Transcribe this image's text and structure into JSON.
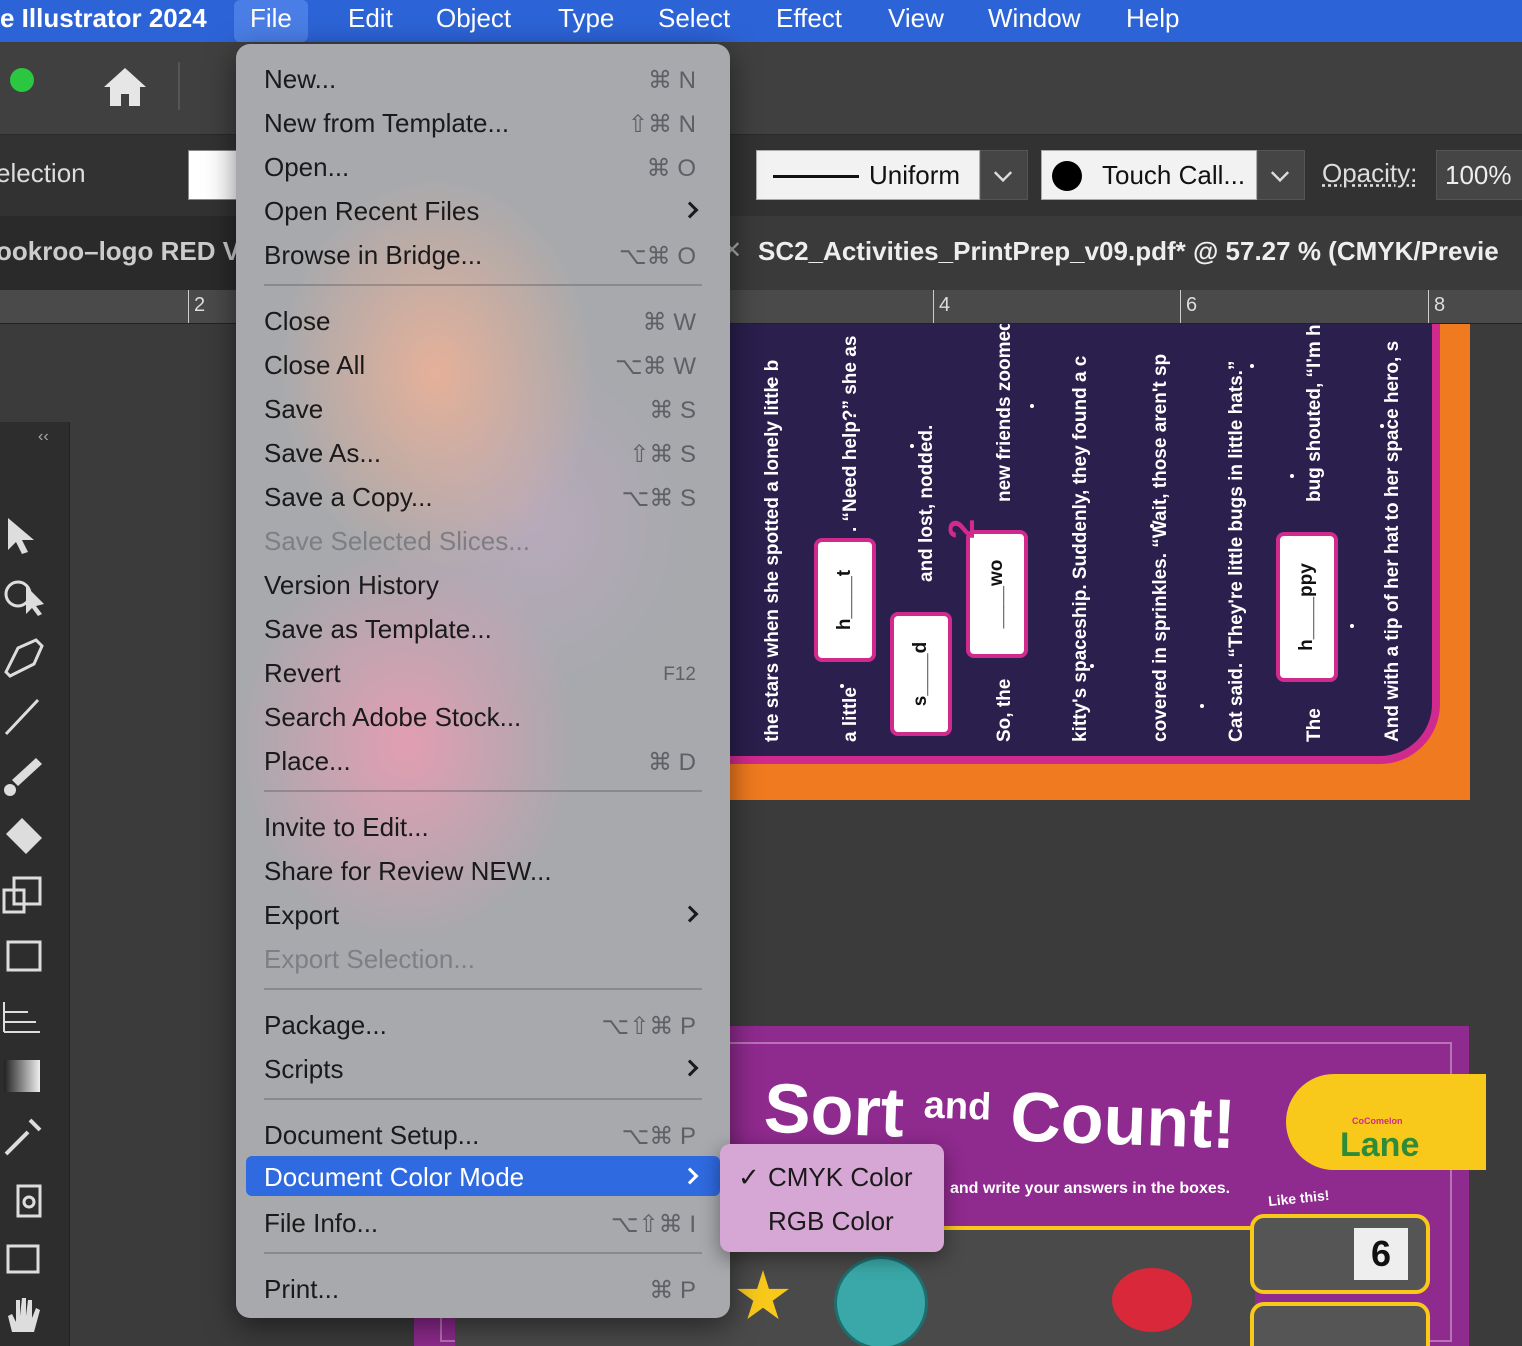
{
  "menubar": {
    "app_name": "e Illustrator 2024",
    "items": [
      "File",
      "Edit",
      "Object",
      "Type",
      "Select",
      "Effect",
      "View",
      "Window",
      "Help"
    ]
  },
  "control_bar": {
    "tool_label": "election",
    "stroke_profile": "Uniform",
    "brush": "Touch Call...",
    "opacity_label": "Opacity:",
    "opacity_value": "100%"
  },
  "tabs": {
    "inactive": "ookroo–logo RED V",
    "active_title": "SC2_Activities_PrintPrep_v09.pdf* @ 57.27 % (CMYK/Previe"
  },
  "ruler": {
    "labels": [
      "2",
      "4",
      "6",
      "8"
    ]
  },
  "file_menu": {
    "items": [
      {
        "label": "New...",
        "shortcut": "⌘ N"
      },
      {
        "label": "New from Template...",
        "shortcut": "⇧⌘ N"
      },
      {
        "label": "Open...",
        "shortcut": "⌘ O"
      },
      {
        "label": "Open Recent Files",
        "submenu": true
      },
      {
        "label": "Browse in Bridge...",
        "shortcut": "⌥⌘ O"
      },
      {
        "label": "Close",
        "shortcut": "⌘ W"
      },
      {
        "label": "Close All",
        "shortcut": "⌥⌘ W"
      },
      {
        "label": "Save",
        "shortcut": "⌘ S"
      },
      {
        "label": "Save As...",
        "shortcut": "⇧⌘ S"
      },
      {
        "label": "Save a Copy...",
        "shortcut": "⌥⌘ S"
      },
      {
        "label": "Save Selected Slices...",
        "disabled": true
      },
      {
        "label": "Version History"
      },
      {
        "label": "Save as Template..."
      },
      {
        "label": "Revert",
        "shortcut": "F12"
      },
      {
        "label": "Search Adobe Stock..."
      },
      {
        "label": "Place...",
        "shortcut": "⌘ D"
      },
      {
        "label": "Invite to Edit..."
      },
      {
        "label": "Share for Review NEW..."
      },
      {
        "label": "Export",
        "submenu": true
      },
      {
        "label": "Export Selection...",
        "disabled": true
      },
      {
        "label": "Package...",
        "shortcut": "⌥⇧⌘ P"
      },
      {
        "label": "Scripts",
        "submenu": true
      },
      {
        "label": "Document Setup...",
        "shortcut": "⌥⌘ P"
      },
      {
        "label": "Document Color Mode",
        "submenu": true,
        "highlighted": true
      },
      {
        "label": "File Info...",
        "shortcut": "⌥⇧⌘ I"
      },
      {
        "label": "Print...",
        "shortcut": "⌘ P"
      }
    ]
  },
  "color_mode_submenu": {
    "items": [
      {
        "label": "CMYK Color",
        "checked": true,
        "check_mark": "✓"
      },
      {
        "label": "RGB Color",
        "checked": false
      }
    ]
  },
  "artboard1": {
    "lines": [
      "the stars when she spotted a lonely little b",
      ". “Need help?” she as",
      "a little",
      "and lost, nodded.",
      "So, the",
      "new friends zoomed",
      "kitty's spaceship. Suddenly, they found a c",
      "covered in sprinkles. “Wait, those aren't sp",
      "Cat said. “They're little bugs in little hats.”",
      "bug shouted, “I'm ho",
      "The",
      "And with a tip of her hat to her space hero, s"
    ],
    "blanks": [
      "h____t",
      "s____d",
      "____wo",
      "h____ppy"
    ],
    "number_badge": "2"
  },
  "artboard2": {
    "title_sort": "Sort",
    "title_and": "and",
    "title_count": "Count!",
    "instruction": "and write your answers in the boxes.",
    "logo_brand": "CoComelon",
    "logo_lane": "Lane",
    "like_this": "Like this!",
    "example_answer": "6"
  },
  "colors": {
    "menubar_blue": "#2c63d6",
    "highlight_blue": "#2f6ae0",
    "artboard_orange": "#f07a1f",
    "artboard_magenta": "#d12a8f",
    "artboard_purple": "#8f2a8e",
    "night_sky": "#2a1f4d",
    "accent_yellow": "#f8c81a"
  }
}
